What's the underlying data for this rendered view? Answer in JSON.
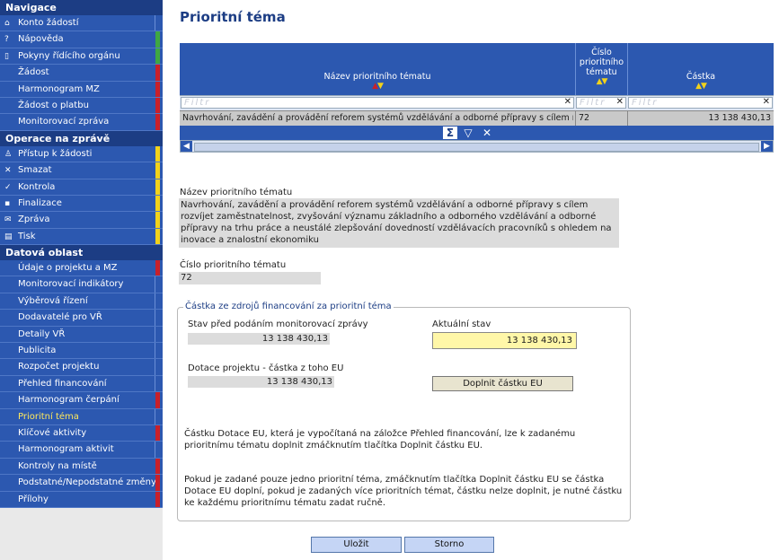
{
  "sidebar": {
    "navigace": {
      "title": "Navigace",
      "items": [
        {
          "label": "Konto žádostí",
          "icon": "home-icon"
        },
        {
          "label": "Nápověda",
          "icon": "help-icon"
        },
        {
          "label": "Pokyny řídícího orgánu",
          "icon": "book-icon"
        },
        {
          "label": "Žádost"
        },
        {
          "label": "Harmonogram MZ"
        },
        {
          "label": "Žádost o platbu"
        },
        {
          "label": "Monitorovací zpráva"
        }
      ]
    },
    "operace": {
      "title": "Operace na zprávě",
      "items": [
        {
          "label": "Přístup k žádosti",
          "icon": "user-icon"
        },
        {
          "label": "Smazat",
          "icon": "delete-icon"
        },
        {
          "label": "Kontrola",
          "icon": "check-icon"
        },
        {
          "label": "Finalizace",
          "icon": "lock-icon"
        },
        {
          "label": "Zpráva",
          "icon": "envelope-icon"
        },
        {
          "label": "Tisk",
          "icon": "print-icon"
        }
      ]
    },
    "datova": {
      "title": "Datová oblast",
      "items": [
        {
          "label": "Údaje o projektu a MZ"
        },
        {
          "label": "Monitorovací indikátory"
        },
        {
          "label": "Výběrová řízení"
        },
        {
          "label": "Dodavatelé pro VŘ"
        },
        {
          "label": "Detaily VŘ"
        },
        {
          "label": "Publicita"
        },
        {
          "label": "Rozpočet projektu"
        },
        {
          "label": "Přehled financování"
        },
        {
          "label": "Harmonogram čerpání"
        },
        {
          "label": "Prioritní téma"
        },
        {
          "label": "Klíčové aktivity"
        },
        {
          "label": "Harmonogram aktivit"
        },
        {
          "label": "Kontroly na místě"
        },
        {
          "label": "Podstatné/Nepodstatné změny"
        },
        {
          "label": "Přílohy"
        }
      ]
    }
  },
  "page": {
    "title": "Prioritní téma"
  },
  "grid": {
    "columns": [
      {
        "label": "Název prioritního tématu"
      },
      {
        "label": "Číslo prioritního tématu"
      },
      {
        "label": "Částka"
      }
    ],
    "filter_placeholder": "Filtr",
    "rows": [
      {
        "name": "Navrhování, zavádění a provádění reforem systémů vzdělávání a odborné přípravy s cílem rozvíjet",
        "number": "72",
        "amount": "13 138 430,13"
      }
    ]
  },
  "detail": {
    "name_label": "Název prioritního tématu",
    "name_value": "Navrhování, zavádění a provádění reforem systémů vzdělávání a odborné přípravy s cílem rozvíjet zaměstnatelnost, zvyšování významu základního a odborného vzdělávání a odborné přípravy na trhu práce a neustálé zlepšování dovedností vzdělávacích pracovníků s ohledem na inovace a znalostní ekonomiku",
    "number_label": "Číslo prioritního tématu",
    "number_value": "72"
  },
  "funding": {
    "legend": "Částka ze zdrojů financování za prioritní téma",
    "before_label": "Stav před podáním monitorovací zprávy",
    "before_value": "13 138 430,13",
    "current_label": "Aktuální stav",
    "current_value": "13 138 430,13",
    "eu_label": "Dotace projektu - částka z toho EU",
    "eu_value": "13 138 430,13",
    "fill_button": "Doplnit částku EU",
    "note1": "Částku Dotace EU, která je vypočítaná na záložce Přehled financování, lze k zadanému prioritnímu tématu doplnit zmáčknutím tlačítka Doplnit částku EU.",
    "note2": "Pokud je zadané pouze jedno prioritní téma, zmáčknutím tlačítka Doplnit částku EU se částka Dotace EU doplní, pokud je zadaných více prioritních témat, částku nelze doplnit, je nutné částku ke každému prioritnímu tématu zadat ručně."
  },
  "buttons": {
    "save": "Uložit",
    "cancel": "Storno"
  }
}
